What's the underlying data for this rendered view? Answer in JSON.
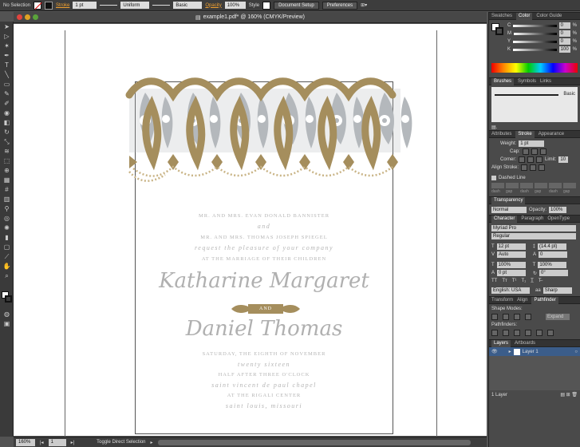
{
  "control_bar": {
    "selection_label": "No Selection",
    "stroke_label": "Stroke",
    "stroke_weight": "1 pt",
    "profile": "Uniform",
    "brush": "Basic",
    "opacity_label": "Opacity",
    "opacity_value": "100%",
    "style_label": "Style",
    "document_setup_button": "Document Setup",
    "preferences_button": "Preferences"
  },
  "document": {
    "tab_title": "example1.pdf* @ 160% (CMYK/Preview)"
  },
  "invitation": {
    "line1": "MR. AND MRS. EVAN DONALD BANNISTER",
    "line2": "and",
    "line3": "MR. AND MRS. THOMAS JOSEPH SPIEGEL",
    "line4": "request the pleasure of your company",
    "line5": "AT THE MARRIAGE OF THEIR CHILDREN",
    "bride": "Katharine Margaret",
    "and_badge": "AND",
    "groom": "Daniel Thomas",
    "date": "SATURDAY, THE EIGHTH OF NOVEMBER",
    "year": "twenty sixteen",
    "time": "HALF AFTER THREE O'CLOCK",
    "venue1": "saint vincent de paul chapel",
    "venue2": "AT THE RIGALI CENTER",
    "city": "saint louis, missouri"
  },
  "status_bar": {
    "zoom": "160%",
    "page": "1",
    "message": "Toggle Direct Selection"
  },
  "panels": {
    "swatches_tab": "Swatches",
    "color_tab": "Color",
    "color_guide_tab": "Color Guide",
    "color_rows": [
      {
        "label": "C",
        "value": "0",
        "unit": "%"
      },
      {
        "label": "M",
        "value": "0",
        "unit": "%"
      },
      {
        "label": "Y",
        "value": "0",
        "unit": "%"
      },
      {
        "label": "K",
        "value": "100",
        "unit": "%"
      }
    ],
    "brushes_tab": "Brushes",
    "symbols_tab": "Symbols",
    "links_tab": "Links",
    "brush_basic": "Basic",
    "attributes_tab": "Attributes",
    "stroke_tab": "Stroke",
    "appearance_tab": "Appearance",
    "weight_label": "Weight:",
    "weight_value": "1 pt",
    "cap_label": "Cap:",
    "corner_label": "Corner:",
    "limit_label": "Limit:",
    "limit_value": "10",
    "align_stroke_label": "Align Stroke:",
    "dashed_line_label": "Dashed Line",
    "dash_labels": [
      "dash",
      "gap",
      "dash",
      "gap",
      "dash",
      "gap"
    ],
    "transparency_tab": "Transparency",
    "blend_mode": "Normal",
    "transp_opacity_label": "Opacity:",
    "transp_opacity": "100%",
    "character_tab": "Character",
    "paragraph_tab": "Paragraph",
    "opentype_tab": "OpenType",
    "font_family": "Myriad Pro",
    "font_style": "Regular",
    "font_size": "12 pt",
    "leading": "(14.4 pt)",
    "kerning": "Auto",
    "tracking": "0",
    "v_scale": "100%",
    "h_scale": "100%",
    "baseline": "0 pt",
    "rotation": "0°",
    "language": "English: USA",
    "antialias": "Sharp",
    "transform_tab": "Transform",
    "align_tab": "Align",
    "pathfinder_tab": "Pathfinder",
    "shape_modes_label": "Shape Modes:",
    "expand_button": "Expand",
    "pathfinders_label": "Pathfinders:",
    "layers_tab": "Layers",
    "artboards_tab": "Artboards",
    "layer_name": "Layer 1",
    "layer_count": "1 Layer"
  },
  "colors": {
    "gold": "#a58e5d",
    "silver": "#b4b8bc",
    "canvas": "#ffffff",
    "chrome": "#535353"
  }
}
